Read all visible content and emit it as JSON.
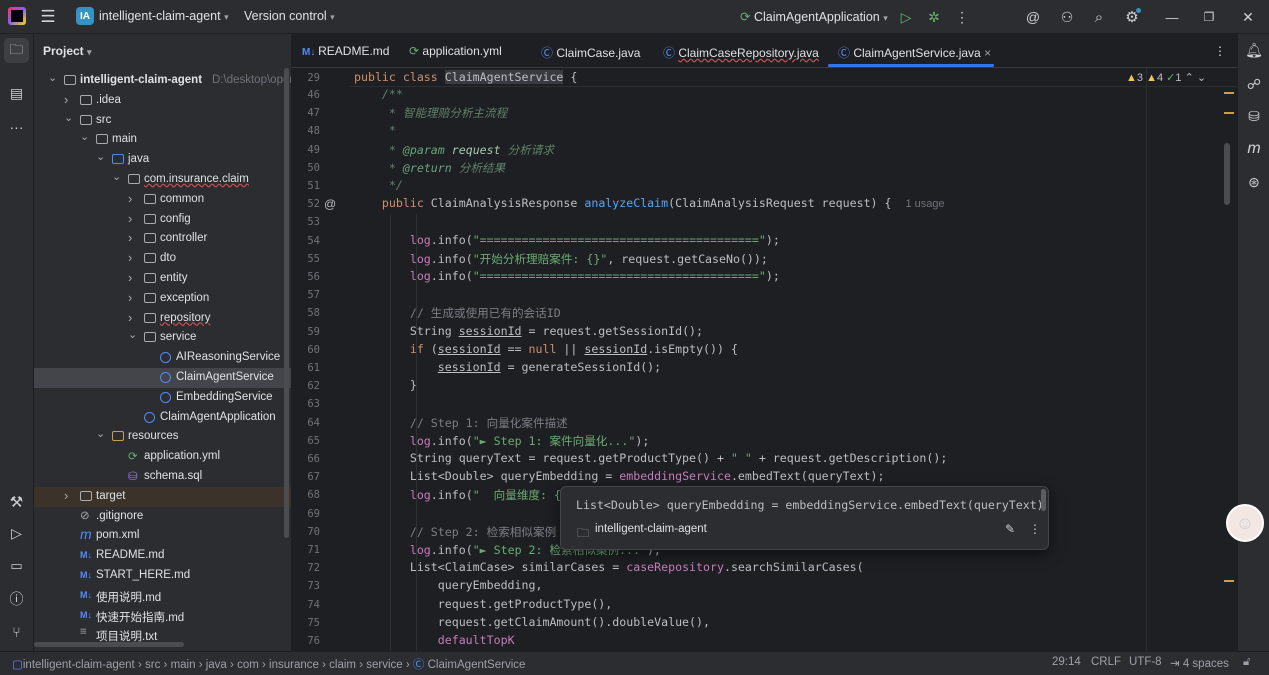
{
  "titlebar": {
    "app_badge": "IA",
    "project_name": "intelligent-claim-agent",
    "vcs": "Version control",
    "run_config": "ClaimAgentApplication"
  },
  "project_panel": {
    "title": "Project",
    "root_name": "intelligent-claim-agent",
    "root_path": "D:\\desktop\\openga",
    "tree": [
      {
        "label": "intelligent-claim-agent",
        "path": "D:\\desktop\\openga",
        "depth": 0,
        "kind": "folder",
        "expanded": true,
        "bold": true
      },
      {
        "label": ".idea",
        "depth": 1,
        "kind": "folder",
        "expanded": false
      },
      {
        "label": "src",
        "depth": 1,
        "kind": "folder",
        "expanded": true
      },
      {
        "label": "main",
        "depth": 2,
        "kind": "folder",
        "expanded": true
      },
      {
        "label": "java",
        "depth": 3,
        "kind": "folder",
        "expanded": true
      },
      {
        "label": "com.insurance.claim",
        "depth": 4,
        "kind": "package",
        "expanded": true
      },
      {
        "label": "common",
        "depth": 5,
        "kind": "package",
        "expanded": false
      },
      {
        "label": "config",
        "depth": 5,
        "kind": "package",
        "expanded": false
      },
      {
        "label": "controller",
        "depth": 5,
        "kind": "package",
        "expanded": false
      },
      {
        "label": "dto",
        "depth": 5,
        "kind": "package",
        "expanded": false
      },
      {
        "label": "entity",
        "depth": 5,
        "kind": "package",
        "expanded": false
      },
      {
        "label": "exception",
        "depth": 5,
        "kind": "package",
        "expanded": false
      },
      {
        "label": "repository",
        "depth": 5,
        "kind": "package",
        "expanded": false
      },
      {
        "label": "service",
        "depth": 5,
        "kind": "package",
        "expanded": true
      },
      {
        "label": "AIReasoningService",
        "depth": 6,
        "kind": "class"
      },
      {
        "label": "ClaimAgentService",
        "depth": 6,
        "kind": "class",
        "selected": true
      },
      {
        "label": "EmbeddingService",
        "depth": 6,
        "kind": "class"
      },
      {
        "label": "ClaimAgentApplication",
        "depth": 5,
        "kind": "class"
      },
      {
        "label": "resources",
        "depth": 3,
        "kind": "folder",
        "expanded": true
      },
      {
        "label": "application.yml",
        "depth": 4,
        "kind": "yml"
      },
      {
        "label": "schema.sql",
        "depth": 4,
        "kind": "sql"
      },
      {
        "label": "target",
        "depth": 1,
        "kind": "folder",
        "expanded": false,
        "excluded": true
      },
      {
        "label": ".gitignore",
        "depth": 1,
        "kind": "gitignore"
      },
      {
        "label": "pom.xml",
        "depth": 1,
        "kind": "maven"
      },
      {
        "label": "README.md",
        "depth": 1,
        "kind": "md"
      },
      {
        "label": "START_HERE.md",
        "depth": 1,
        "kind": "md"
      },
      {
        "label": "使用说明.md",
        "depth": 1,
        "kind": "md"
      },
      {
        "label": "快速开始指南.md",
        "depth": 1,
        "kind": "md"
      },
      {
        "label": "项目说明.txt",
        "depth": 1,
        "kind": "txt"
      }
    ]
  },
  "tabs": [
    {
      "label": "README.md",
      "icon": "markdown-icon"
    },
    {
      "label": "application.yml",
      "icon": "yaml-icon"
    },
    {
      "label": "ClaimCase.java",
      "icon": "class-icon"
    },
    {
      "label": "ClaimCaseRepository.java",
      "icon": "class-icon",
      "underline": true
    },
    {
      "label": "ClaimAgentService.java",
      "icon": "class-icon",
      "active": true
    }
  ],
  "inspections": {
    "warnings": "3",
    "weak_warnings": "4",
    "typos": "1"
  },
  "editor": {
    "sticky_line": {
      "number": "29",
      "text": "public class ClaimAgentService {"
    },
    "lines": [
      {
        "n": "46"
      },
      {
        "n": "47"
      },
      {
        "n": "48"
      },
      {
        "n": "49"
      },
      {
        "n": "50"
      },
      {
        "n": "51"
      },
      {
        "n": "52",
        "gutter": "@"
      },
      {
        "n": "53"
      },
      {
        "n": "54"
      },
      {
        "n": "55"
      },
      {
        "n": "56"
      },
      {
        "n": "57"
      },
      {
        "n": "58"
      },
      {
        "n": "59"
      },
      {
        "n": "60"
      },
      {
        "n": "61"
      },
      {
        "n": "62"
      },
      {
        "n": "63"
      },
      {
        "n": "64"
      },
      {
        "n": "65"
      },
      {
        "n": "66"
      },
      {
        "n": "67"
      },
      {
        "n": "68"
      },
      {
        "n": "69"
      },
      {
        "n": "70"
      },
      {
        "n": "71"
      },
      {
        "n": "72"
      },
      {
        "n": "73"
      },
      {
        "n": "74"
      },
      {
        "n": "75"
      },
      {
        "n": "76"
      }
    ],
    "usage_hint": "1 usage"
  },
  "popup": {
    "code": "List<Double> queryEmbedding = embeddingService.embedText(queryText)",
    "project": "intelligent-claim-agent"
  },
  "breadcrumb": [
    "intelligent-claim-agent",
    "src",
    "main",
    "java",
    "com",
    "insurance",
    "claim",
    "service",
    "ClaimAgentService"
  ],
  "status": {
    "position": "29:14",
    "line_sep": "CRLF",
    "encoding": "UTF-8",
    "indent": "4 spaces"
  }
}
